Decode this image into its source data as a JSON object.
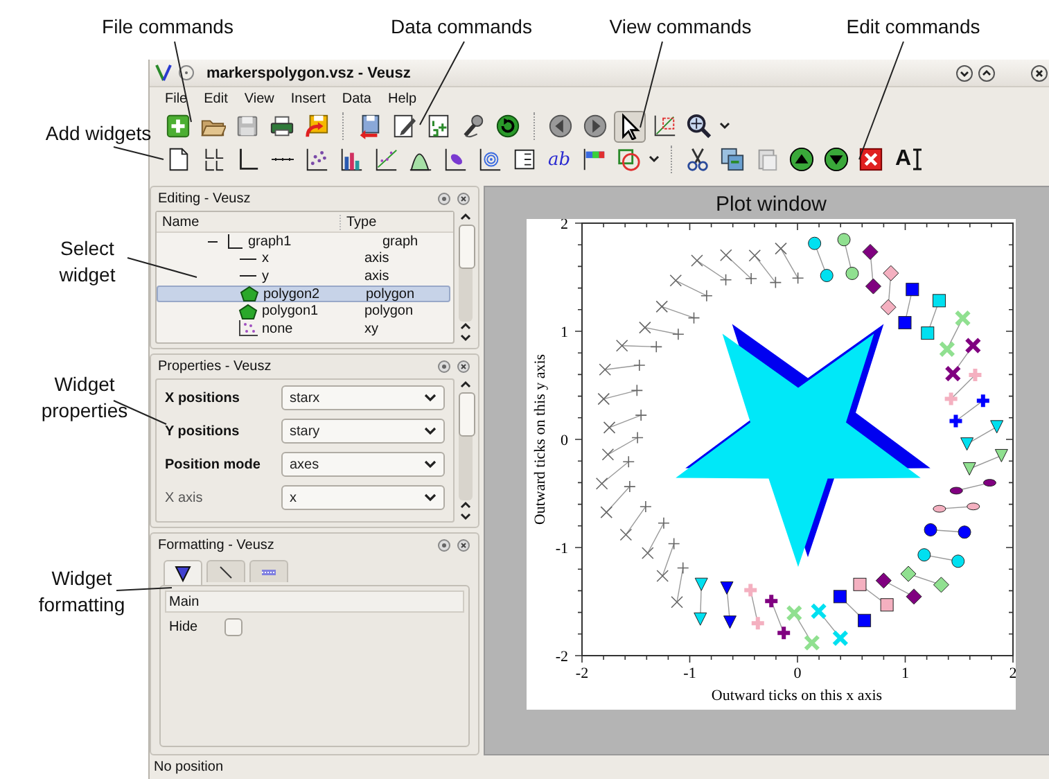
{
  "annotations": {
    "top": [
      "File commands",
      "Data commands",
      "View commands",
      "Edit commands"
    ],
    "left": [
      "Add widgets",
      "Select widget",
      "Widget properties",
      "Widget formatting"
    ]
  },
  "window": {
    "title": "markerspolygon.vsz - Veusz"
  },
  "menu": [
    "File",
    "Edit",
    "View",
    "Insert",
    "Data",
    "Help"
  ],
  "toolbar": {
    "pointer_selected": true,
    "label_button_text": "ab",
    "text_button_text": "A"
  },
  "editing_panel": {
    "title": "Editing - Veusz",
    "columns": [
      "Name",
      "Type"
    ],
    "tree": [
      {
        "name": "graph1",
        "type": "graph",
        "kind": "graph",
        "expanded": true,
        "selected": false,
        "children": [
          {
            "name": "x",
            "type": "axis",
            "kind": "axis",
            "selected": false
          },
          {
            "name": "y",
            "type": "axis",
            "kind": "axis",
            "selected": false
          },
          {
            "name": "polygon2",
            "type": "polygon",
            "kind": "polygon",
            "selected": true
          },
          {
            "name": "polygon1",
            "type": "polygon",
            "kind": "polygon",
            "selected": false
          },
          {
            "name": "none",
            "type": "xy",
            "kind": "xy",
            "selected": false
          }
        ]
      }
    ]
  },
  "properties_panel": {
    "title": "Properties - Veusz",
    "rows": [
      {
        "label": "X positions",
        "value": "starx",
        "modified": true
      },
      {
        "label": "Y positions",
        "value": "stary",
        "modified": true
      },
      {
        "label": "Position mode",
        "value": "axes",
        "modified": true
      },
      {
        "label": "X axis",
        "value": "x",
        "modified": false
      }
    ]
  },
  "formatting_panel": {
    "title": "Formatting - Veusz",
    "tabs": [
      {
        "kind": "marker",
        "selected": true
      },
      {
        "kind": "line",
        "selected": false
      },
      {
        "kind": "fill",
        "selected": false
      }
    ],
    "section": "Main",
    "rows": [
      {
        "label": "Hide",
        "checked": false
      }
    ]
  },
  "plot": {
    "title": "Plot window",
    "xlabel": "Outward ticks on this x axis",
    "ylabel": "Outward ticks on this y axis",
    "xtick_labels": [
      "-2",
      "-1",
      "0",
      "1",
      "2"
    ],
    "ytick_labels": [
      "2",
      "1",
      "0",
      "-1",
      "-2"
    ]
  },
  "status_bar": "No position"
}
